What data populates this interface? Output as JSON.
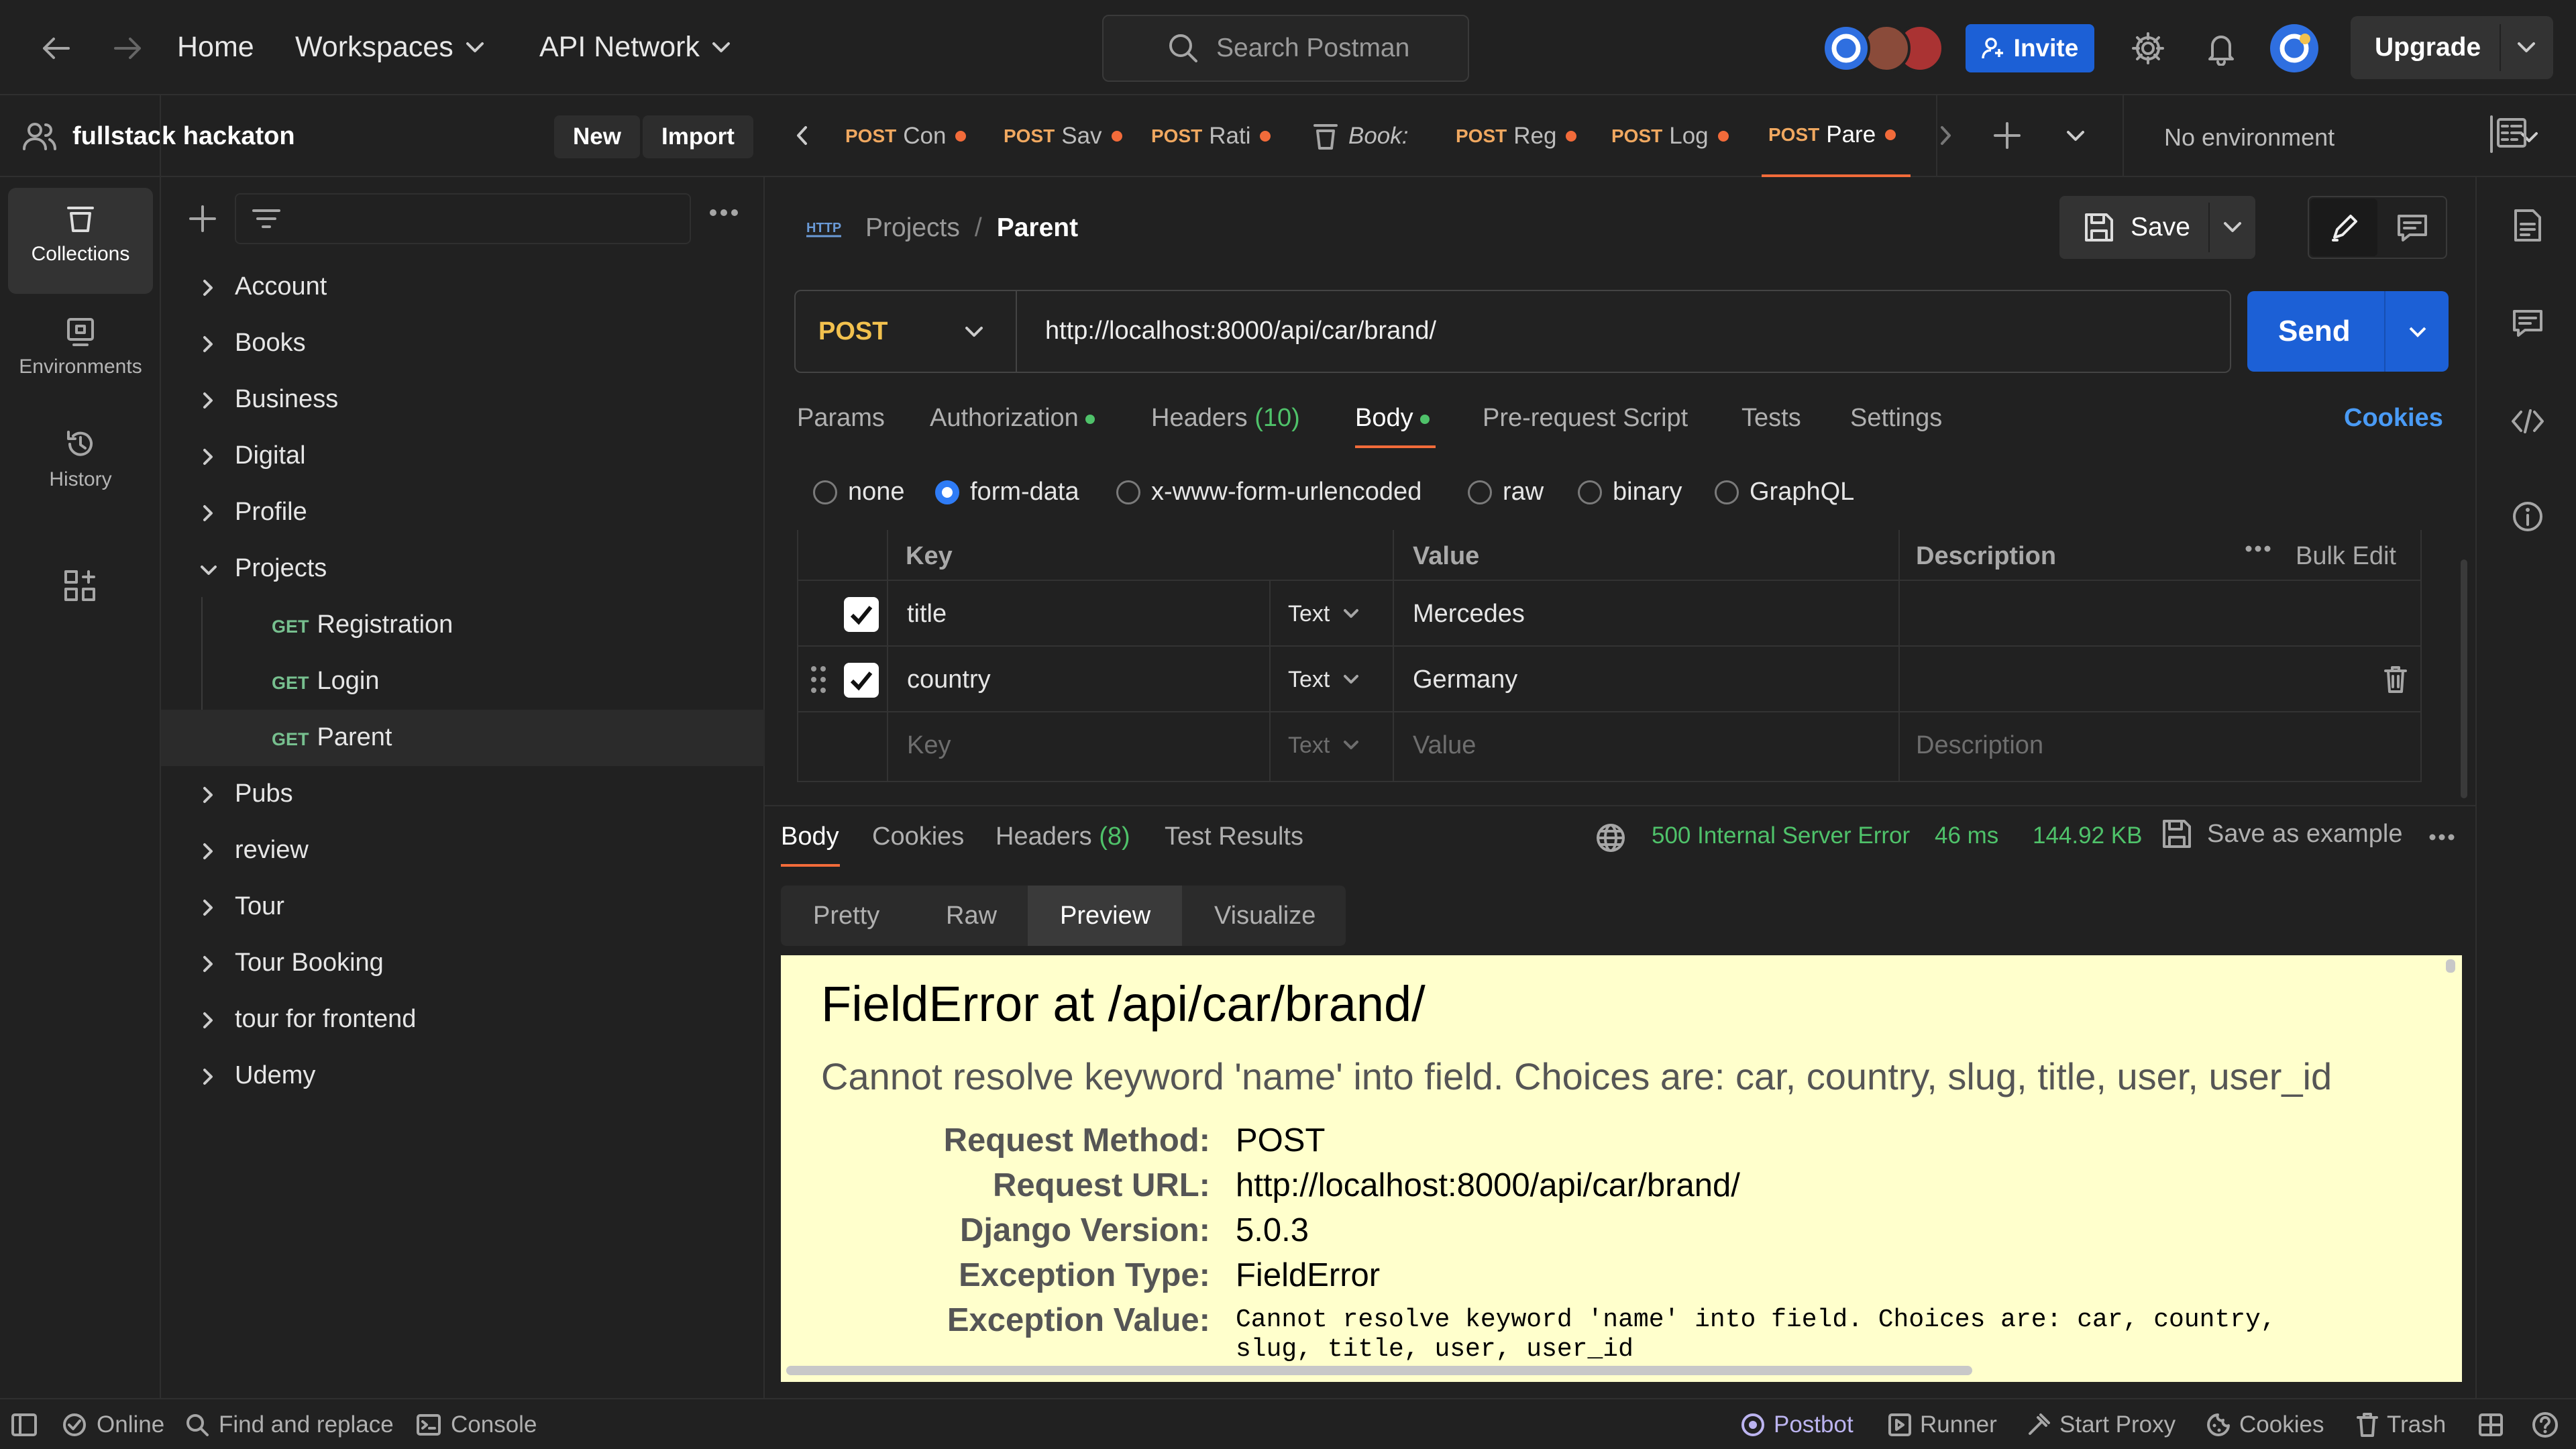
{
  "nav": {
    "home": "Home",
    "workspaces": "Workspaces",
    "api_network": "API Network",
    "search_placeholder": "Search Postman",
    "invite": "Invite",
    "upgrade": "Upgrade"
  },
  "workspace": {
    "name": "fullstack hackaton",
    "new_label": "New",
    "import_label": "Import"
  },
  "rail": {
    "items": [
      {
        "label": "Collections",
        "icon": "collections-icon"
      },
      {
        "label": "Environments",
        "icon": "environments-icon"
      },
      {
        "label": "History",
        "icon": "history-icon"
      }
    ]
  },
  "sidebar": {
    "collections": [
      {
        "name": "Account",
        "expanded": false
      },
      {
        "name": "Books",
        "expanded": false
      },
      {
        "name": "Business",
        "expanded": false
      },
      {
        "name": "Digital",
        "expanded": false
      },
      {
        "name": "Profile",
        "expanded": false
      },
      {
        "name": "Projects",
        "expanded": true
      },
      {
        "name": "Pubs",
        "expanded": false
      },
      {
        "name": "review",
        "expanded": false
      },
      {
        "name": "Tour",
        "expanded": false
      },
      {
        "name": "Tour Booking",
        "expanded": false
      },
      {
        "name": "tour for frontend",
        "expanded": false
      },
      {
        "name": "Udemy",
        "expanded": false
      }
    ],
    "requests": [
      {
        "method": "GET",
        "name": "Registration"
      },
      {
        "method": "GET",
        "name": "Login"
      },
      {
        "method": "GET",
        "name": "Parent"
      }
    ]
  },
  "tabs": [
    {
      "method": "POST",
      "name": "Con"
    },
    {
      "method": "POST",
      "name": "Sav"
    },
    {
      "method": "POST",
      "name": "Rati"
    },
    {
      "method": "",
      "name": "Book:"
    },
    {
      "method": "POST",
      "name": "Reg"
    },
    {
      "method": "POST",
      "name": "Log"
    },
    {
      "method": "POST",
      "name": "Pare"
    }
  ],
  "environment": "No environment",
  "request": {
    "breadcrumb_parent": "Projects",
    "breadcrumb_sep": "/",
    "breadcrumb_current": "Parent",
    "save": "Save",
    "method": "POST",
    "url": "http://localhost:8000/api/car/brand/",
    "send": "Send",
    "tabs": {
      "params": "Params",
      "authorization": "Authorization",
      "headers": "Headers",
      "headers_count": "(10)",
      "body": "Body",
      "pre_request": "Pre-request Script",
      "tests": "Tests",
      "settings": "Settings",
      "cookies": "Cookies"
    },
    "body_types": [
      "none",
      "form-data",
      "x-www-form-urlencoded",
      "raw",
      "binary",
      "GraphQL"
    ],
    "body_type_selected": "form-data",
    "table": {
      "headers": {
        "key": "Key",
        "value": "Value",
        "description": "Description",
        "bulk_edit": "Bulk Edit"
      },
      "rows": [
        {
          "key": "title",
          "type": "Text",
          "value": "Mercedes",
          "checked": true
        },
        {
          "key": "country",
          "type": "Text",
          "value": "Germany",
          "checked": true
        }
      ],
      "placeholder": {
        "key": "Key",
        "type": "Text",
        "value": "Value",
        "description": "Description"
      }
    }
  },
  "response": {
    "tabs": {
      "body": "Body",
      "cookies": "Cookies",
      "headers": "Headers",
      "headers_count": "(8)",
      "test_results": "Test Results"
    },
    "status": "500 Internal Server Error",
    "time": "46 ms",
    "size": "144.92 KB",
    "save_example": "Save as example",
    "view_tabs": [
      "Pretty",
      "Raw",
      "Preview",
      "Visualize"
    ],
    "view_selected": "Preview",
    "preview": {
      "title": "FieldError at /api/car/brand/",
      "subtitle": "Cannot resolve keyword 'name' into field. Choices are: car, country, slug, title, user, user_id",
      "rows": [
        {
          "k": "Request Method:",
          "v": "POST"
        },
        {
          "k": "Request URL:",
          "v": "http://localhost:8000/api/car/brand/"
        },
        {
          "k": "Django Version:",
          "v": "5.0.3"
        },
        {
          "k": "Exception Type:",
          "v": "FieldError"
        }
      ],
      "exception_value_label": "Exception Value:",
      "exception_value_line1": "Cannot resolve keyword 'name' into field. Choices are: car, country,",
      "exception_value_line2": "slug, title, user, user_id"
    }
  },
  "statusbar": {
    "online": "Online",
    "find_replace": "Find and replace",
    "console": "Console",
    "postbot": "Postbot",
    "runner": "Runner",
    "start_proxy": "Start Proxy",
    "cookies": "Cookies",
    "trash": "Trash"
  },
  "colors": {
    "accent_blue": "#1c60d6",
    "tab_dot": "#f26b3a",
    "get_green": "#77c08f",
    "post_orange": "#f0a860",
    "status_green": "#4fc26a",
    "preview_bg": "#ffffcc"
  }
}
